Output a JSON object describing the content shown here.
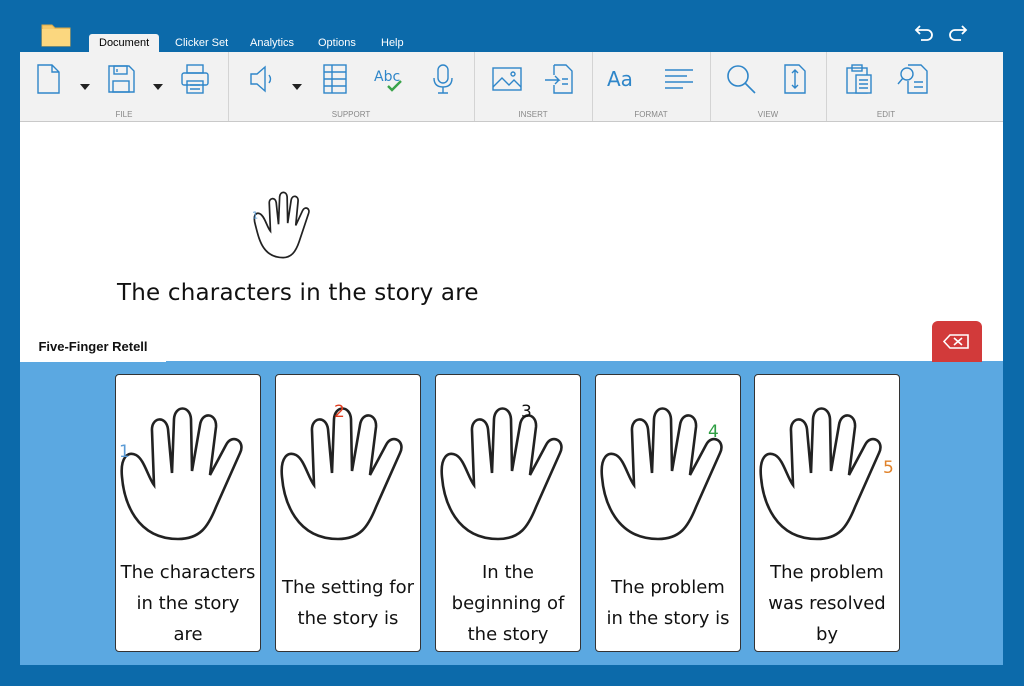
{
  "toolbar": {
    "tabs": [
      "Document",
      "Clicker Set",
      "Analytics",
      "Options",
      "Help"
    ],
    "active_tab": "Document"
  },
  "ribbon": {
    "groups": [
      "FILE",
      "SUPPORT",
      "INSERT",
      "FORMAT",
      "VIEW",
      "EDIT"
    ],
    "abc_label": "Abc",
    "aa_label": "Aa"
  },
  "document": {
    "sentence": "The characters in the story are"
  },
  "panel": {
    "title": "Five-Finger Retell",
    "cards": [
      {
        "number": "1",
        "color": "#5b9bd5",
        "text": [
          "The characters",
          "in the story",
          "are"
        ]
      },
      {
        "number": "2",
        "color": "#e03c1f",
        "text": [
          "The setting for",
          "the story is"
        ]
      },
      {
        "number": "3",
        "color": "#111111",
        "text": [
          "In the",
          "beginning of",
          "the story"
        ]
      },
      {
        "number": "4",
        "color": "#2e9e43",
        "text": [
          "The problem",
          "in the story is"
        ]
      },
      {
        "number": "5",
        "color": "#e0822a",
        "text": [
          "The problem",
          "was resolved",
          "by"
        ]
      }
    ]
  },
  "colors": {
    "background": "#0c6aaa",
    "panel": "#5ba8e1",
    "delete_button": "#d23a3a",
    "icon_blue": "#2f86c9"
  },
  "icons": [
    "folder-icon",
    "undo-icon",
    "redo-icon",
    "new-document-icon",
    "save-icon",
    "print-icon",
    "speaker-icon",
    "word-list-icon",
    "spellcheck-icon",
    "microphone-icon",
    "insert-picture-icon",
    "insert-file-icon",
    "font-icon",
    "align-icon",
    "search-icon",
    "page-size-icon",
    "paste-icon",
    "find-replace-icon",
    "backspace-icon",
    "hand-icon"
  ]
}
